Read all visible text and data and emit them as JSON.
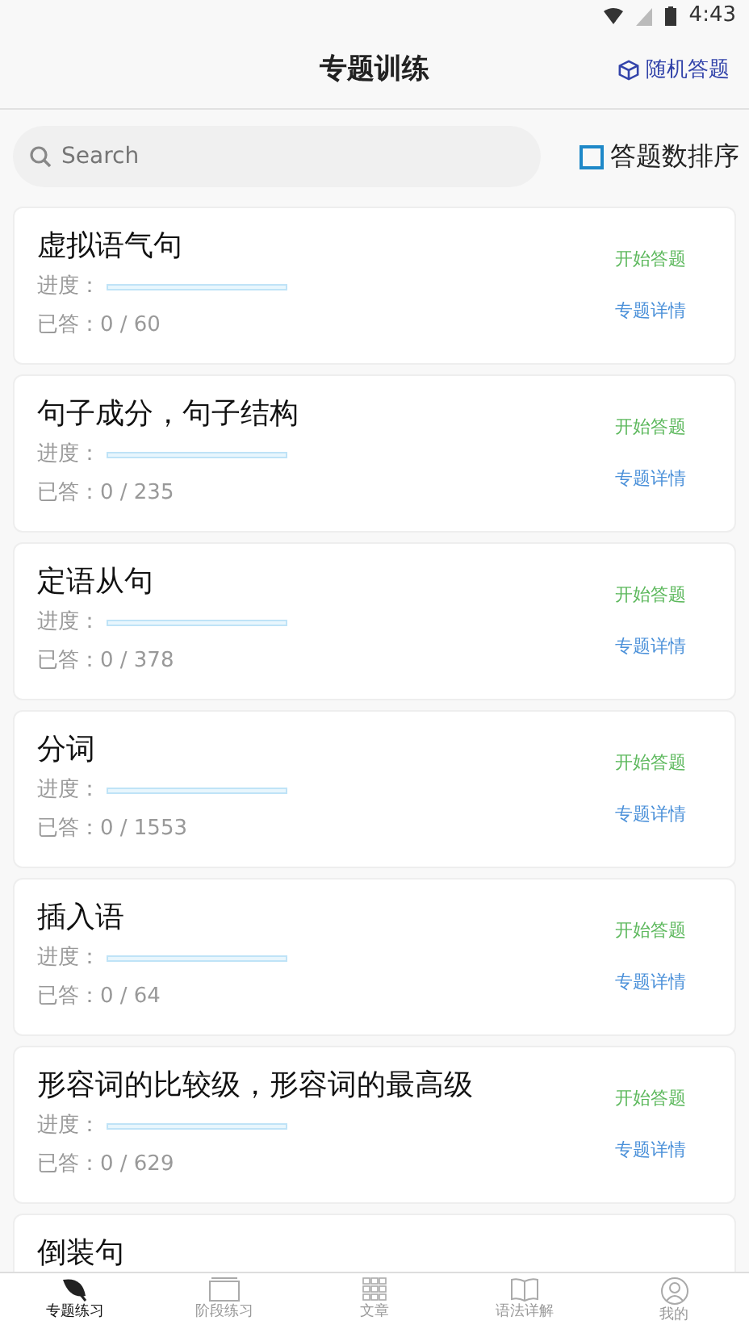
{
  "status_bar": {
    "time": "4:43"
  },
  "header": {
    "title": "专题训练",
    "action": "随机答题"
  },
  "search": {
    "placeholder": "Search"
  },
  "sort": {
    "label": "答题数排序",
    "checked": false
  },
  "topics": [
    {
      "title": "虚拟语气句",
      "progress_label": "进度：",
      "level": 0,
      "answered": "已答：0 / 60",
      "start": "开始答题",
      "details": "专题详情"
    },
    {
      "title": "句子成分，句子结构",
      "progress_label": "进度：",
      "level": 0,
      "answered": "已答：0 / 235",
      "start": "开始答题",
      "details": "专题详情"
    },
    {
      "title": "定语从句",
      "progress_label": "进度：",
      "level": 0,
      "answered": "已答：0 / 378",
      "start": "开始答题",
      "details": "专题详情"
    },
    {
      "title": "分词",
      "progress_label": "进度：",
      "level": 0,
      "answered": "已答：0 / 1553",
      "start": "开始答题",
      "details": "专题详情"
    },
    {
      "title": "插入语",
      "progress_label": "进度：",
      "level": 0,
      "answered": "已答：0 / 64",
      "start": "开始答题",
      "details": "专题详情"
    },
    {
      "title": "形容词的比较级，形容词的最高级",
      "progress_label": "进度：",
      "level": 0,
      "answered": "已答：0 / 629",
      "start": "开始答题",
      "details": "专题详情"
    },
    {
      "title": "倒装句"
    }
  ],
  "tabs": [
    {
      "label": "专题练习",
      "selected": true
    },
    {
      "label": "阶段练习",
      "selected": false
    },
    {
      "label": "文章",
      "selected": false
    },
    {
      "label": "语法详解",
      "selected": false
    },
    {
      "label": "我的",
      "selected": false
    }
  ]
}
